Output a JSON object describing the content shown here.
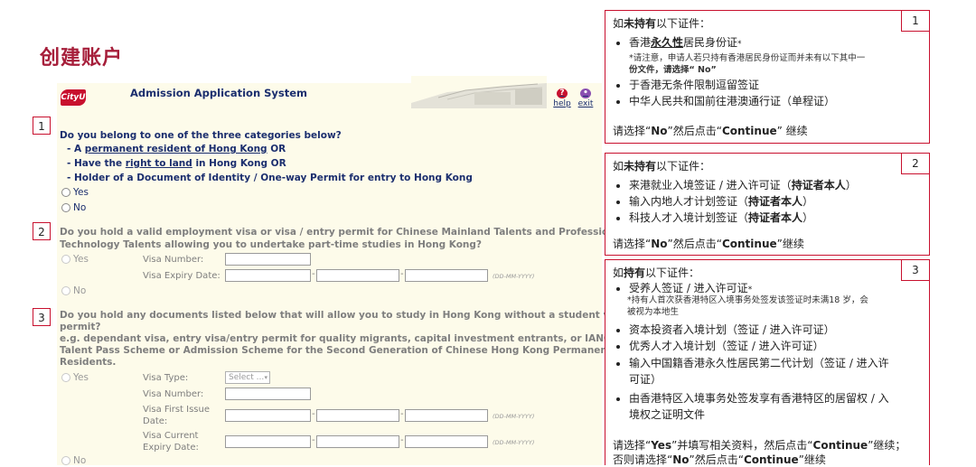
{
  "page": {
    "title": "创建账户"
  },
  "app": {
    "logo_text": "CityU",
    "name": "Admission Application System",
    "help_label": "help",
    "exit_label": "exit",
    "date_hint": "(DD-MM-YYYY)"
  },
  "q1": {
    "num": "1",
    "question": "Do you belong to one of the three categories below?",
    "item1_pre": "- A ",
    "item1_link": "permanent resident of Hong Kong",
    "item1_post": " OR",
    "item2_pre": "- Have the ",
    "item2_link": "right to land",
    "item2_post": " in Hong Kong OR",
    "item3": "- Holder of a Document of Identity / One-way Permit for entry to Hong Kong",
    "yes": "Yes",
    "no": "No"
  },
  "q2": {
    "num": "2",
    "question_line1": "Do you hold a valid employment visa or visa / entry permit for Chinese Mainland Talents and Professionals /",
    "question_line2": "Technology Talents allowing you to undertake part-time studies in Hong Kong?",
    "yes": "Yes",
    "no": "No",
    "visa_number_label": "Visa Number:",
    "visa_expiry_label": "Visa Expiry Date:"
  },
  "q3": {
    "num": "3",
    "question_line1": "Do you hold any documents listed below that will allow you to study in Hong Kong without a student visa/entry",
    "question_line2": "permit?",
    "eg_line1": "e.g. dependant visa, entry visa/entry permit for quality migrants, capital investment entrants, or IANG visa or Top",
    "eg_line2": "Talent Pass Scheme or Admission Scheme for the Second Generation of Chinese Hong Kong Permanent",
    "eg_line3": "Residents.",
    "yes": "Yes",
    "no": "No",
    "visa_type_label": "Visa Type:",
    "visa_type_value": "Select ...",
    "visa_number_label": "Visa Number:",
    "first_issue_label_1": "Visa First Issue",
    "first_issue_label_2": "Date:",
    "current_expiry_label_1": "Visa Current",
    "current_expiry_label_2": "Expiry Date:"
  },
  "cards": [
    {
      "num": "1",
      "head_pre": "如",
      "head_bold": "未持有",
      "head_post": "以下证件：",
      "b1_pre": "香港",
      "b1_bold": "永久性",
      "b1_post": "居民身份证",
      "b1_star": "*",
      "note_line1": "*请注意，申请人若只持有香港居民身份证而并未有以下其中一",
      "note_line2": "份文件，请选择“ No”",
      "b2": "于香港无条件限制逗留签证",
      "b3": "中华人民共和国前往港澳通行证（单程证）",
      "foot_pre": "请选择“",
      "foot_bold1": "No",
      "foot_mid": "”然后点击“",
      "foot_bold2": "Continue",
      "foot_post": "” 继续"
    },
    {
      "num": "2",
      "head_pre": "如",
      "head_bold": "未持有",
      "head_post": "以下证件：",
      "b1": "来港就业入境签证 / 进入许可证（",
      "b1_bold": "持证者本人",
      "b1_end": "）",
      "b2": "输入内地人才计划签证（",
      "b2_bold": "持证者本人",
      "b2_end": "）",
      "b3": "科技人才入境计划签证（",
      "b3_bold": "持证者本人",
      "b3_end": "）",
      "foot_pre": "请选择“",
      "foot_bold1": "No",
      "foot_mid": "”然后点击“",
      "foot_bold2": "Continue",
      "foot_post": "”继续"
    },
    {
      "num": "3",
      "head_pre": "如",
      "head_bold": "持有",
      "head_post": "以下证件：",
      "b1": "受养人签证 / 进入许可证",
      "b1_star": "*",
      "note_line1": "*持有人首次获香港特区入境事务处签发该签证时未满18 岁，会",
      "note_line2": "被视为本地生",
      "b2": "资本投资者入境计划（签证 / 进入许可证）",
      "b3": "优秀人才入境计划（签证 / 进入许可证）",
      "b4_line1": "输入中国籍香港永久性居民第二代计划（签证 / 进入许",
      "b4_line2": "可证）",
      "b5_line1": "由香港特区入境事务处签发享有香港特区的居留权 / 入",
      "b5_line2": "境权之证明文件",
      "foot1_pre": "请选择“",
      "foot1_bold1": "Yes",
      "foot1_mid": "”并填写相关资料，然后点击“",
      "foot1_bold2": "Continue",
      "foot1_post": "”继续；",
      "foot2_pre": "否则请选择“",
      "foot2_bold1": "No",
      "foot2_mid": "”然后点击“",
      "foot2_bold2": "Continue",
      "foot2_post": "”继续"
    }
  ],
  "colors": {
    "accent": "#c8102e",
    "title": "#a61e3a",
    "form_bg": "#fdfbea",
    "label_blue": "#1b2e6e",
    "disabled_grey": "#7e7e7e"
  }
}
